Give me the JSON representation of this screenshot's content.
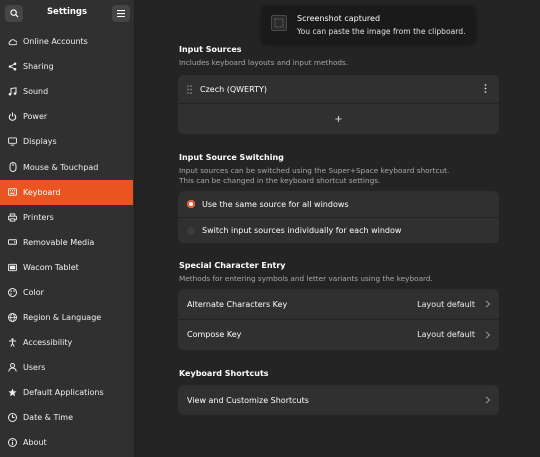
{
  "sidebar": {
    "title": "Settings",
    "items": [
      {
        "label": "Online Accounts",
        "icon": "cloud-icon"
      },
      {
        "label": "Sharing",
        "icon": "share-icon"
      },
      {
        "label": "Sound",
        "icon": "music-note-icon"
      },
      {
        "label": "Power",
        "icon": "power-icon"
      },
      {
        "label": "Displays",
        "icon": "display-icon"
      },
      {
        "label": "Mouse & Touchpad",
        "icon": "mouse-icon"
      },
      {
        "label": "Keyboard",
        "icon": "keyboard-icon"
      },
      {
        "label": "Printers",
        "icon": "printer-icon"
      },
      {
        "label": "Removable Media",
        "icon": "drive-icon"
      },
      {
        "label": "Wacom Tablet",
        "icon": "tablet-icon"
      },
      {
        "label": "Color",
        "icon": "palette-icon"
      },
      {
        "label": "Region & Language",
        "icon": "globe-icon"
      },
      {
        "label": "Accessibility",
        "icon": "accessibility-icon"
      },
      {
        "label": "Users",
        "icon": "users-icon"
      },
      {
        "label": "Default Applications",
        "icon": "star-icon"
      },
      {
        "label": "Date & Time",
        "icon": "clock-icon"
      },
      {
        "label": "About",
        "icon": "info-icon"
      }
    ],
    "active": "Keyboard"
  },
  "main": {
    "input_sources": {
      "title": "Input Sources",
      "desc": "Includes keyboard layouts and input methods.",
      "source": "Czech (QWERTY)",
      "add_symbol": "+"
    },
    "switching": {
      "title": "Input Source Switching",
      "desc_line1": "Input sources can be switched using the Super+Space keyboard shortcut.",
      "desc_line2": "This can be changed in the keyboard shortcut settings.",
      "option_same": "Use the same source for all windows",
      "option_individual": "Switch input sources individually for each window",
      "selected": "option_same"
    },
    "special": {
      "title": "Special Character Entry",
      "desc": "Methods for entering symbols and letter variants using the keyboard.",
      "alt_label": "Alternate Characters Key",
      "alt_value": "Layout default",
      "compose_label": "Compose Key",
      "compose_value": "Layout default"
    },
    "shortcuts": {
      "title": "Keyboard Shortcuts",
      "row_label": "View and Customize Shortcuts"
    }
  },
  "toast": {
    "title": "Screenshot captured",
    "body": "You can paste the image from the clipboard."
  },
  "colors": {
    "accent": "#e95420",
    "background": "#242424",
    "sidebar": "#303030",
    "card": "#303030"
  }
}
